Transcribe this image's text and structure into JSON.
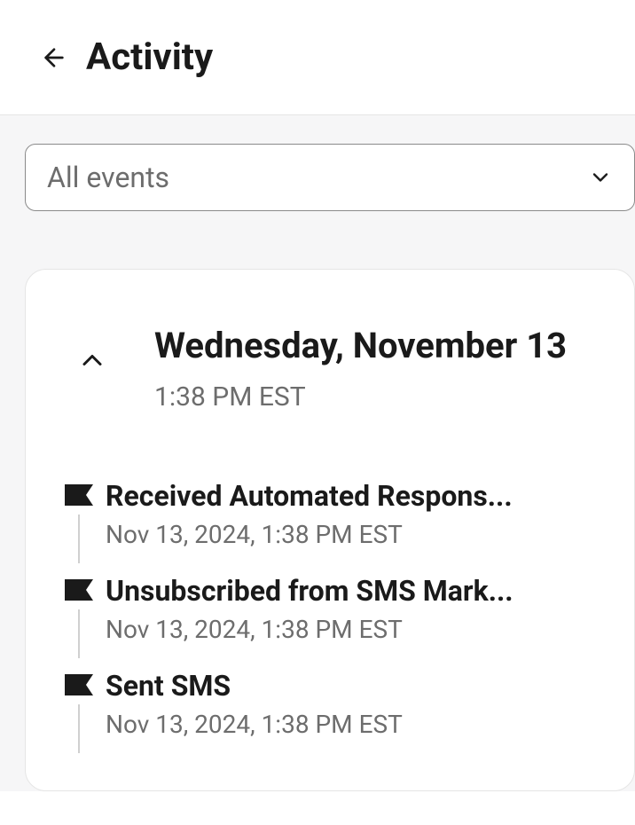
{
  "header": {
    "title": "Activity"
  },
  "filter": {
    "selected": "All events"
  },
  "dateGroup": {
    "date": "Wednesday, November 13",
    "time": "1:38 PM EST"
  },
  "events": [
    {
      "title": "Received Automated Respons...",
      "timestamp": "Nov 13, 2024, 1:38 PM EST"
    },
    {
      "title": "Unsubscribed from SMS Mark...",
      "timestamp": "Nov 13, 2024, 1:38 PM EST"
    },
    {
      "title": "Sent SMS",
      "timestamp": "Nov 13, 2024, 1:38 PM EST"
    }
  ]
}
